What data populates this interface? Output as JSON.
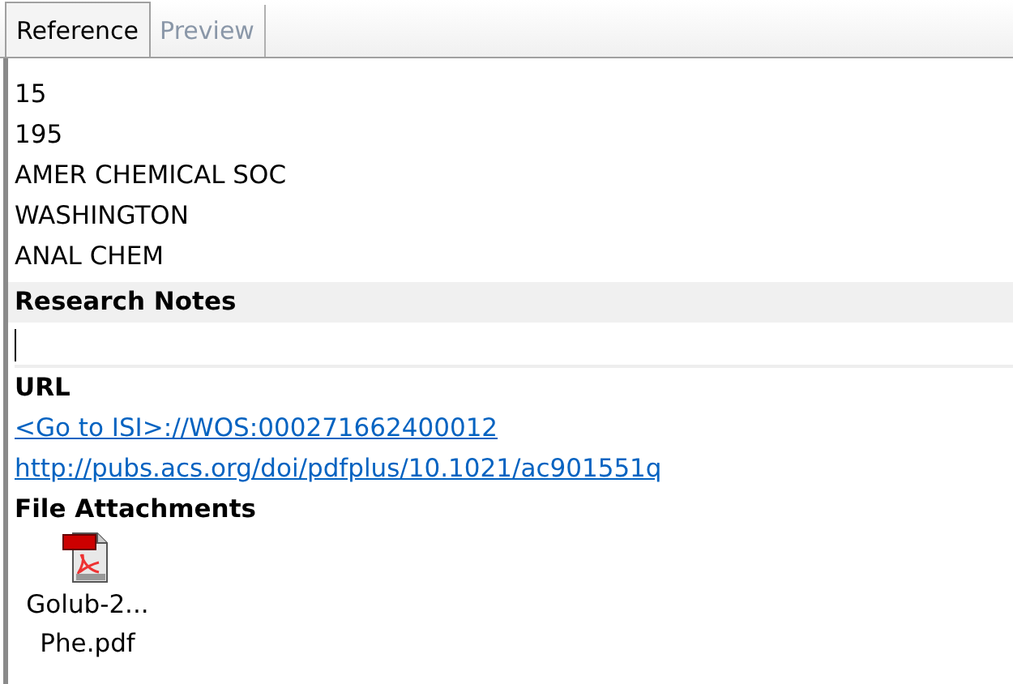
{
  "tabs": [
    {
      "label": "Reference",
      "selected": true
    },
    {
      "label": "Preview",
      "selected": false
    }
  ],
  "fields": [
    "15",
    "195",
    "AMER CHEMICAL SOC",
    "WASHINGTON",
    "ANAL CHEM"
  ],
  "research_notes": {
    "label": "Research Notes"
  },
  "url": {
    "label": "URL",
    "links": [
      "<Go to ISI>://WOS:000271662400012",
      "http://pubs.acs.org/doi/pdfplus/10.1021/ac901551q"
    ]
  },
  "file_attachments": {
    "label": "File Attachments",
    "files": [
      {
        "name_lines": [
          "Golub-2...",
          "Phe.pdf"
        ]
      }
    ]
  }
}
